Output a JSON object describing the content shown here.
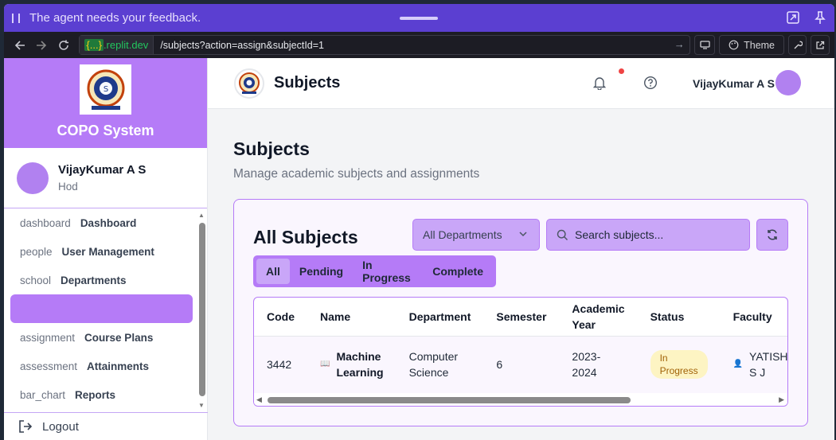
{
  "banner": {
    "text": "The agent needs your feedback."
  },
  "browser": {
    "domain_brace": "{...}",
    "domain_host": ".replit.dev",
    "path": "/subjects?action=assign&subjectId=1",
    "theme_label": "Theme"
  },
  "sidebar": {
    "title": "COPO System",
    "user_name": "VijayKumar A S",
    "user_role": "Hod",
    "items": [
      {
        "icon": "dashboard",
        "label": "Dashboard"
      },
      {
        "icon": "people",
        "label": "User Management"
      },
      {
        "icon": "school",
        "label": "Departments"
      },
      {
        "icon": "",
        "label": ""
      },
      {
        "icon": "assignment",
        "label": "Course Plans"
      },
      {
        "icon": "assessment",
        "label": "Attainments"
      },
      {
        "icon": "bar_chart",
        "label": "Reports"
      }
    ],
    "logout_label": "Logout"
  },
  "topbar": {
    "title": "Subjects",
    "user_name": "VijayKumar A S"
  },
  "page": {
    "title": "Subjects",
    "subtitle": "Manage academic subjects and assignments"
  },
  "card": {
    "title": "All Subjects",
    "department_select": "All Departments",
    "search_placeholder": "Search subjects...",
    "tabs": [
      "All",
      "Pending",
      "In Progress",
      "Complete"
    ]
  },
  "table": {
    "headers": [
      "Code",
      "Name",
      "Department",
      "Semester",
      "Academic Year",
      "Status",
      "Faculty"
    ],
    "rows": [
      {
        "code": "3442",
        "name": "Machine Learning",
        "department": "Computer Science",
        "semester": "6",
        "year": "2023-2024",
        "status": "In Progress",
        "faculty": "YATISH S J"
      }
    ]
  },
  "colors": {
    "accent": "#b57bf7",
    "banner": "#5b3fd1",
    "badge_bg": "#fdf4c3",
    "badge_text": "#a16207",
    "notification": "#ef4444"
  }
}
